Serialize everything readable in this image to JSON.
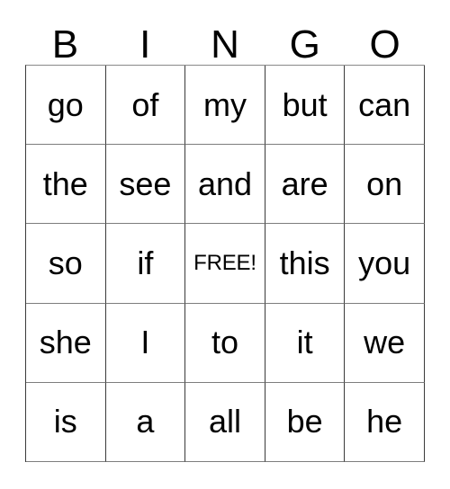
{
  "card": {
    "title": "BINGO",
    "header_letters": [
      "B",
      "I",
      "N",
      "G",
      "O"
    ],
    "free_space": {
      "row": 2,
      "col": 2,
      "label": "FREE!"
    },
    "grid_size": "5x5",
    "colors": {
      "background": "#ffffff",
      "text": "#000000",
      "grid_line": "#3a3a3a"
    },
    "rows": [
      {
        "cells": [
          {
            "text": "go",
            "free": false
          },
          {
            "text": "of",
            "free": false
          },
          {
            "text": "my",
            "free": false
          },
          {
            "text": "but",
            "free": false
          },
          {
            "text": "can",
            "free": false
          }
        ]
      },
      {
        "cells": [
          {
            "text": "the",
            "free": false
          },
          {
            "text": "see",
            "free": false
          },
          {
            "text": "and",
            "free": false
          },
          {
            "text": "are",
            "free": false
          },
          {
            "text": "on",
            "free": false
          }
        ]
      },
      {
        "cells": [
          {
            "text": "so",
            "free": false
          },
          {
            "text": "if",
            "free": false
          },
          {
            "text": "FREE!",
            "free": true
          },
          {
            "text": "this",
            "free": false
          },
          {
            "text": "you",
            "free": false
          }
        ]
      },
      {
        "cells": [
          {
            "text": "she",
            "free": false
          },
          {
            "text": "I",
            "free": false
          },
          {
            "text": "to",
            "free": false
          },
          {
            "text": "it",
            "free": false
          },
          {
            "text": "we",
            "free": false
          }
        ]
      },
      {
        "cells": [
          {
            "text": "is",
            "free": false
          },
          {
            "text": "a",
            "free": false
          },
          {
            "text": "all",
            "free": false
          },
          {
            "text": "be",
            "free": false
          },
          {
            "text": "he",
            "free": false
          }
        ]
      }
    ]
  }
}
